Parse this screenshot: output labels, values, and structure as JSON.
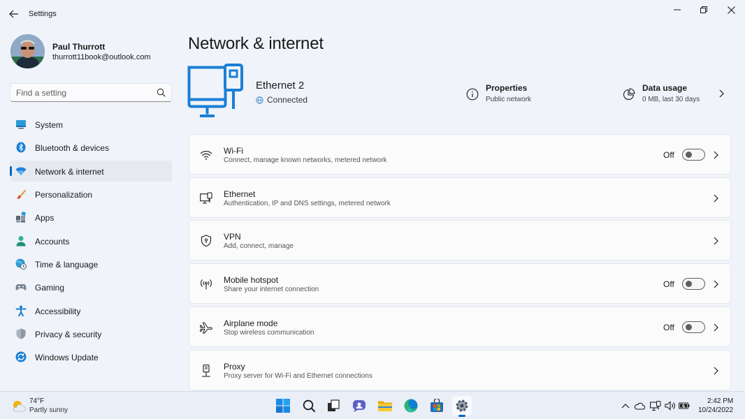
{
  "window": {
    "title": "Settings"
  },
  "profile": {
    "name": "Paul Thurrott",
    "email": "thurrott11book@outlook.com"
  },
  "search": {
    "placeholder": "Find a setting"
  },
  "nav": {
    "items": [
      {
        "label": "System",
        "icon": "system-icon"
      },
      {
        "label": "Bluetooth & devices",
        "icon": "bluetooth-icon"
      },
      {
        "label": "Network & internet",
        "icon": "network-icon",
        "active": true
      },
      {
        "label": "Personalization",
        "icon": "brush-icon"
      },
      {
        "label": "Apps",
        "icon": "apps-icon"
      },
      {
        "label": "Accounts",
        "icon": "person-icon"
      },
      {
        "label": "Time & language",
        "icon": "globe-clock-icon"
      },
      {
        "label": "Gaming",
        "icon": "gamepad-icon"
      },
      {
        "label": "Accessibility",
        "icon": "accessibility-icon"
      },
      {
        "label": "Privacy & security",
        "icon": "shield-icon"
      },
      {
        "label": "Windows Update",
        "icon": "update-icon"
      }
    ]
  },
  "main": {
    "title": "Network & internet",
    "hero": {
      "name": "Ethernet 2",
      "status": "Connected"
    },
    "properties": {
      "title": "Properties",
      "subtitle": "Public network"
    },
    "data_usage": {
      "title": "Data usage",
      "subtitle": "0 MB, last 30 days"
    },
    "cards": [
      {
        "title": "Wi-Fi",
        "subtitle": "Connect, manage known networks, metered network",
        "toggle": "Off",
        "icon": "wifi-icon"
      },
      {
        "title": "Ethernet",
        "subtitle": "Authentication, IP and DNS settings, metered network",
        "icon": "ethernet-icon"
      },
      {
        "title": "VPN",
        "subtitle": "Add, connect, manage",
        "icon": "vpn-shield-icon"
      },
      {
        "title": "Mobile hotspot",
        "subtitle": "Share your internet connection",
        "toggle": "Off",
        "icon": "hotspot-icon"
      },
      {
        "title": "Airplane mode",
        "subtitle": "Stop wireless communication",
        "toggle": "Off",
        "icon": "airplane-icon"
      },
      {
        "title": "Proxy",
        "subtitle": "Proxy server for Wi-Fi and Ethernet connections",
        "icon": "proxy-icon"
      }
    ]
  },
  "taskbar": {
    "weather": {
      "temp": "74°F",
      "desc": "Partly sunny"
    },
    "clock": {
      "time": "2:42 PM",
      "date": "10/24/2022"
    }
  },
  "colors": {
    "accent": "#0067c0",
    "background": "#f0f3f9",
    "card": "#fbfbfc"
  }
}
